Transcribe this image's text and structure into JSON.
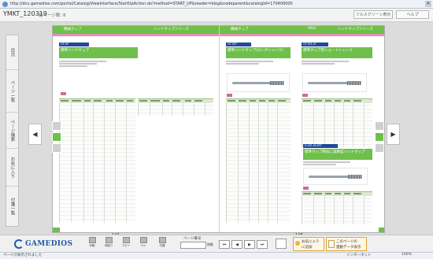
{
  "browser": {
    "url": "http://dcu.gamedios.com/portal/Catalog/ViewInterface/StartUpAction.do?method=START_UP&reader=blog&nodeparent&catalogId=170400000",
    "status_text": "ページが表示されました",
    "status_zone": "インターネット",
    "zoom": "100%"
  },
  "viewer": {
    "title": "YMKT_120319",
    "page_label": "総ページ数: 8",
    "fullscreen_label": "フルスクリーン表示",
    "help_label": "ヘルプ",
    "side_tabs": [
      "目次",
      "ページ一覧",
      "ページ検索",
      "お気に入り",
      "付箋一覧"
    ]
  },
  "spread": {
    "left": {
      "header_category": "機械タップ",
      "header_section": "ハンドタップシリーズ",
      "product_code": "HT-SP",
      "product_title": "標準ハンドタップ",
      "page_number": "147"
    },
    "right": {
      "header_category": "機械タップ",
      "header_mark": "MSH",
      "header_section": "ハンドタップシリーズ",
      "product_a_code": "GT-SPT",
      "product_a_title": "標準ハンドタップ(ロングシャンク)",
      "product_b_code": "GT-SPL-M",
      "product_b_title": "標準タップ用ショートシャンク",
      "product_c_code": "S-SPL-M-SPT",
      "product_c_title": "標準タップ用ねじ高精度ハンドタップ",
      "page_number": "148"
    }
  },
  "toolbar": {
    "logo": "GAMEDIOS",
    "tools": [
      {
        "name": "print",
        "label": "印刷"
      },
      {
        "name": "bookmark",
        "label": "切取り"
      },
      {
        "name": "copy",
        "label": "コピー"
      },
      {
        "name": "pen",
        "label": "ペン"
      },
      {
        "name": "sticky",
        "label": "付箋"
      }
    ],
    "pagenum_label": "ページ番号",
    "pagenum_go": "移動",
    "nav": {
      "first": "⏮",
      "prev": "◀",
      "next": "▶",
      "last": "⏭"
    },
    "favorite_label_1": "お気に入り",
    "favorite_label_2": "に追加",
    "data_label_1": "このページの",
    "data_label_2": "連動データ表示"
  },
  "colors": {
    "accent_green": "#6fbf4b",
    "accent_pink": "#e58fb5",
    "code_blue": "#1f4a9a",
    "logo_blue": "#1d5aa8",
    "fav_orange": "#e3a23a"
  }
}
